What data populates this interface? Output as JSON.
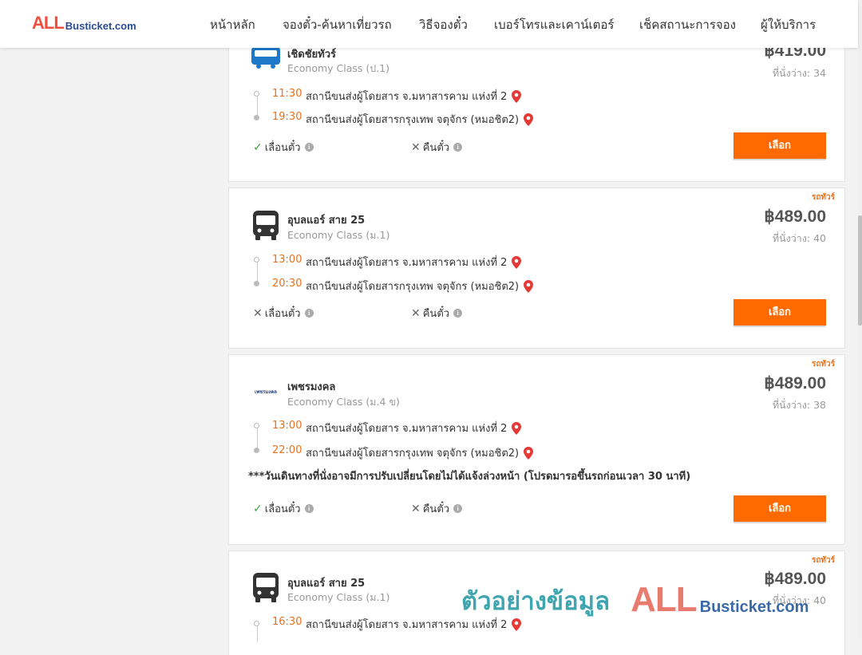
{
  "logo": {
    "big": "ALL",
    "small": "Busticket.com"
  },
  "nav": [
    {
      "label": "หน้าหลัก"
    },
    {
      "label": "จองตั๋ว-ค้นหาเที่ยวรถ"
    },
    {
      "label": "วิธีจองตั๋ว"
    },
    {
      "label": "เบอร์โทรและเคาน์เตอร์"
    },
    {
      "label": "เช็คสถานะการจอง"
    },
    {
      "label": "ผู้ให้บริการ"
    }
  ],
  "common": {
    "tag": "รถทัวร์",
    "seats_label": "ที่นั่งว่าง:",
    "reschedule": "เลื่อนตั๋ว",
    "refund": "คืนตั๋ว",
    "select_button": "เลือก"
  },
  "trips": [
    {
      "operator": "เชิดชัยทัวร์",
      "logo_text": "เชิดชัย ทัวร์",
      "class": "Economy Class (ป.1)",
      "price": "฿419.00",
      "seats": "34",
      "depart_time": "11:30",
      "depart_station": "สถานีขนส่งผู้โดยสาร จ.มหาสารคาม แห่งที่ 2",
      "arrive_time": "19:30",
      "arrive_station": "สถานีขนส่งผู้โดยสารกรุงเทพ จตุจักร (หมอชิต2)",
      "reschedule_allowed": true,
      "refund_allowed": false
    },
    {
      "operator": "อุบลแอร์ สาย 25",
      "class": "Economy Class (ม.1)",
      "price": "฿489.00",
      "seats": "40",
      "depart_time": "13:00",
      "depart_station": "สถานีขนส่งผู้โดยสาร จ.มหาสารคาม แห่งที่ 2",
      "arrive_time": "20:30",
      "arrive_station": "สถานีขนส่งผู้โดยสารกรุงเทพ จตุจักร (หมอชิต2)",
      "reschedule_allowed": false,
      "refund_allowed": false
    },
    {
      "operator": "เพชรมงคล",
      "logo_text": "เพชรมงคล",
      "class": "Economy Class (ม.4 ข)",
      "price": "฿489.00",
      "seats": "38",
      "depart_time": "13:00",
      "depart_station": "สถานีขนส่งผู้โดยสาร จ.มหาสารคาม แห่งที่ 2",
      "arrive_time": "22:00",
      "arrive_station": "สถานีขนส่งผู้โดยสารกรุงเทพ จตุจักร (หมอชิต2)",
      "notice": "***วันเดินทางที่นั่งอาจมีการปรับเปลี่ยนโดยไม่ได้แจ้งล่วงหน้า (โปรดมารอขึ้นรถก่อนเวลา 30 นาที)",
      "reschedule_allowed": true,
      "refund_allowed": false
    },
    {
      "operator": "อุบลแอร์ สาย 25",
      "class": "Economy Class (ม.1)",
      "price": "฿489.00",
      "seats": "40",
      "depart_time": "16:30",
      "depart_station": "สถานีขนส่งผู้โดยสาร จ.มหาสารคาม แห่งที่ 2"
    }
  ],
  "watermark": {
    "text": "ตัวอย่างข้อมูล",
    "big": "ALL",
    "small": "Busticket.com"
  },
  "colors": {
    "accent": "#ff6a00",
    "time": "#e8711c",
    "pin": "#e53935",
    "check": "#3aa83a"
  }
}
